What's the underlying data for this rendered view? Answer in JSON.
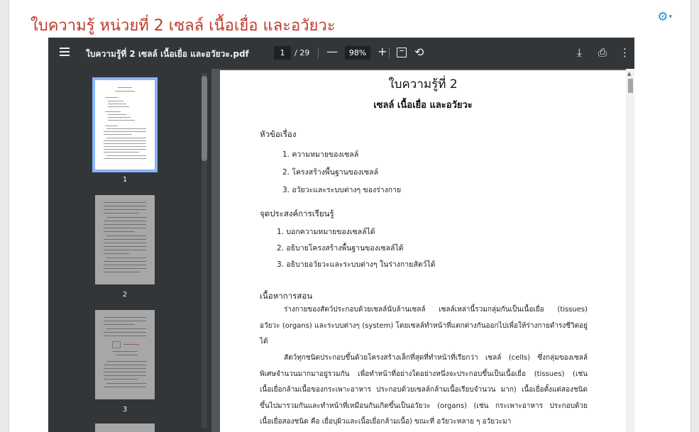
{
  "page": {
    "title": "ใบความรู้ หน่วยที่ 2 เซลล์ เนื้อเยื่อ และอวัยวะ",
    "settings_icon": "gear-icon"
  },
  "toolbar": {
    "file_name": "ใบความรู้ที่ 2 เซลล์ เนื้อเยื่อ และอวัยวะ.pdf",
    "current_page": "1",
    "page_total": "/ 29",
    "zoom_out": "—",
    "zoom": "98%",
    "zoom_in": "+",
    "rotate": "⟲",
    "download": "⤓",
    "print": "⎙",
    "more": "⋮"
  },
  "sidebar": {
    "thumbnails": [
      {
        "label": "1",
        "active": true
      },
      {
        "label": "2",
        "active": false
      },
      {
        "label": "3",
        "active": false
      }
    ]
  },
  "document": {
    "heading": "ใบความรู้ที่ 2",
    "subheading": "เซลล์ เนื้อเยื่อ และอวัยวะ",
    "topics_title": "หัวข้อเรื่อง",
    "topics": [
      "1. ความหมายของเซลล์",
      "2. โครงสร้างพื้นฐานของเซลล์",
      "3. อวัยวะและระบบต่างๆ ของร่างกาย"
    ],
    "objectives_title": "จุดประสงค์การเรียนรู้",
    "objectives": [
      "1. บอกความหมายของเซลล์ได้",
      "2. อธิบายโครงสร้างพื้นฐานของเซลล์ได้",
      "3. อธิบายอวัยวะและระบบต่างๆ ในร่างกายสัตว์ได้"
    ],
    "content_title": "เนื้อหาการสอน",
    "paragraph1": "ร่างกายของสัตว์ประกอบด้วยเซลล์นับล้านเซลล์ เซลล์เหล่านี้รวมกลุ่มกันเป็นเนื้อเยื่อ (tissues) อวัยวะ (organs) และระบบต่างๆ (system) โดยเซลล์ทำหน้าที่แตกต่างกันออกไปเพื่อให้ร่างกายดำรงชีวิตอยู่ได้",
    "paragraph2": "สัตว์ทุกชนิดประกอบขึ้นด้วยโครงสร้างเล็กที่สุดที่ทำหน้าที่เรียกว่า เซลล์ (cells) ซึ่งกลุ่มของเซลล์พิเศษจำนวนมากมาอยู่รวมกัน เพื่อทำหน้าที่อย่างใดอย่างหนึ่งจะประกอบขึ้นเป็นเนื้อเยื่อ (tissues) (เช่น เนื้อเยื่อกล้ามเนื้อของกระเพาะอาหาร ประกอบด้วยเซลล์กล้ามเนื้อเรียบจำนวน มาก) เนื้อเยื่อตั้งแต่สองชนิดขึ้นไปมารวมกันและทำหน้าที่เหมือนกันเกิดขึ้นเป็นอวัยวะ (organs) (เช่น กระเพาะอาหาร ประกอบด้วยเนื้อเยื่อสองชนิด คือ เยื่อบุผิวและเนื้อเยื่อกล้ามเนื้อ) ขณะที่ อวัยวะหลาย ๆ อวัยวะมา"
  }
}
